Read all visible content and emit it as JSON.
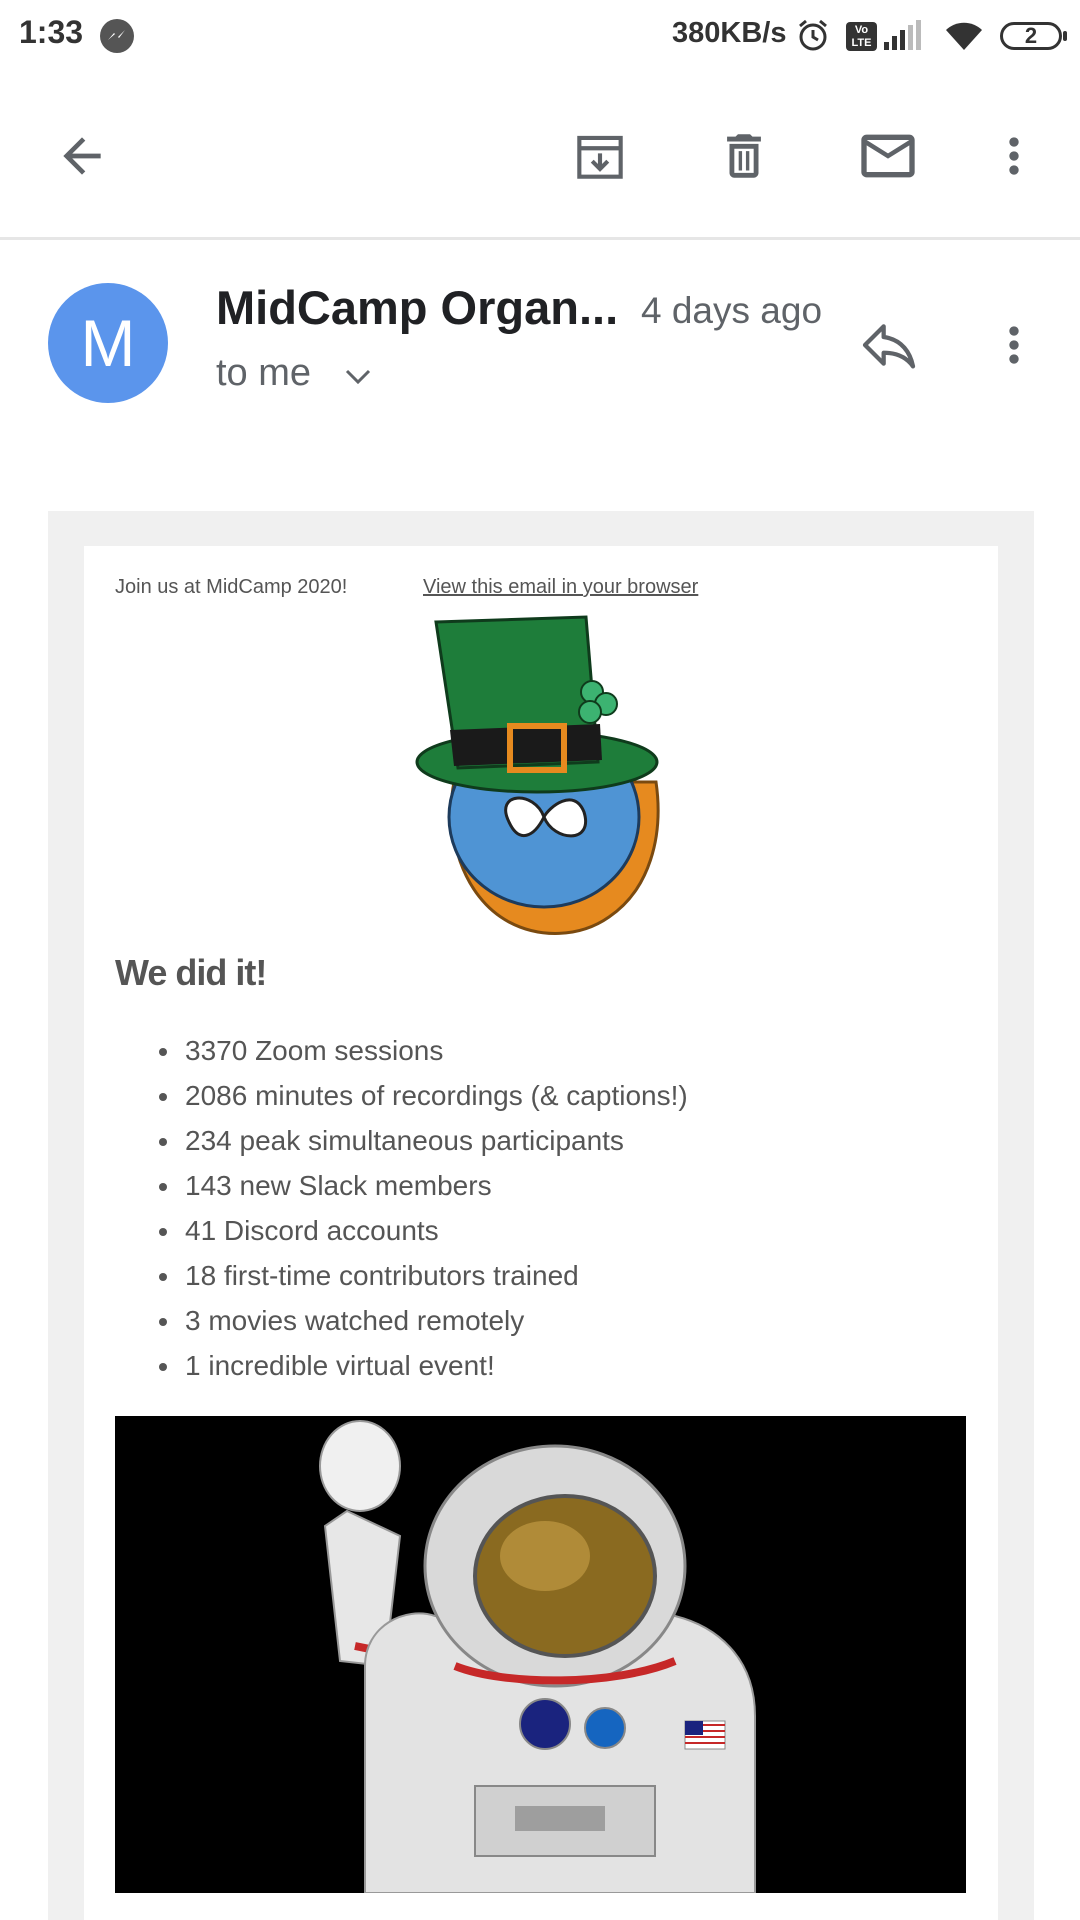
{
  "status_bar": {
    "time": "1:33",
    "network_speed": "380KB/s",
    "volte_label": "Vo LTE",
    "battery_level": "2"
  },
  "app_bar": {
    "back_icon": "arrow-left-icon",
    "actions": [
      "archive-icon",
      "delete-icon",
      "mark-unread-icon",
      "more-vert-icon"
    ]
  },
  "message_header": {
    "avatar_letter": "M",
    "avatar_color": "#5b95ec",
    "sender": "MidCamp Organ...",
    "date": "4 days ago",
    "recipient": "to me"
  },
  "email": {
    "preheader": "Join us at MidCamp 2020!",
    "view_in_browser": "View this email in your browser",
    "headline": "We did it!",
    "stats": [
      "3370 Zoom sessions",
      "2086 minutes of recordings (& captions!)",
      "234 peak simultaneous participants",
      "143 new Slack members",
      "41 Discord accounts",
      "18 first-time contributors trained",
      "3 movies watched remotely",
      "1 incredible virtual event!"
    ]
  },
  "colors": {
    "avatar": "#5b95ec",
    "hat": "#1e7d3a",
    "drop": "#4f94d4",
    "beard": "#e68a1f"
  }
}
